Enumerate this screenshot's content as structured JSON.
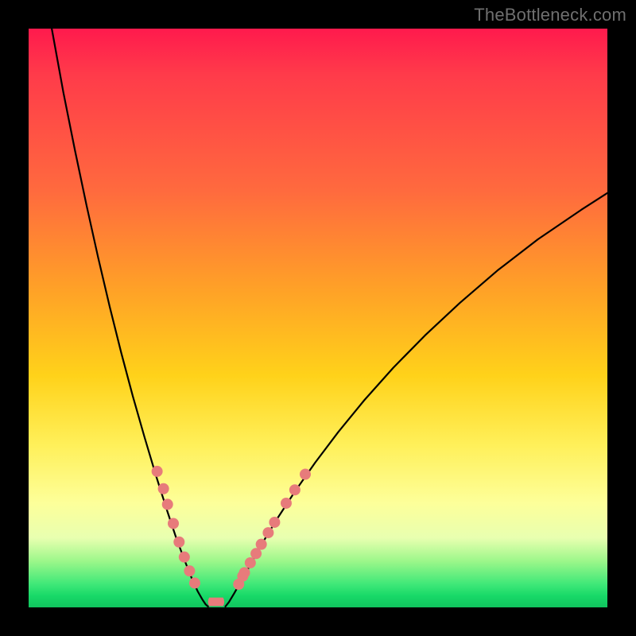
{
  "watermark": "TheBottleneck.com",
  "colors": {
    "curve_stroke": "#000000",
    "dot_fill": "#e77b7b",
    "dot_stroke": "#c95a5a",
    "bottom_arc_fill": "#e77b7b",
    "bottom_arc_stroke": "#c95a5a"
  },
  "chart_data": {
    "type": "line",
    "title": "",
    "xlabel": "",
    "ylabel": "",
    "xlim": [
      0,
      100
    ],
    "ylim": [
      0,
      100
    ],
    "series": [
      {
        "name": "left-branch",
        "x": [
          4,
          6,
          8,
          10,
          12,
          14,
          16,
          18,
          20,
          22,
          24,
          25.5,
          27,
          28.2,
          29.2,
          30,
          30.6,
          31
        ],
        "y": [
          100,
          89,
          79,
          69.5,
          60.5,
          52,
          44,
          36.5,
          29.5,
          22.8,
          16.5,
          12,
          8,
          5,
          2.8,
          1.4,
          0.5,
          0.15
        ]
      },
      {
        "name": "right-branch",
        "x": [
          34,
          34.6,
          35.5,
          36.8,
          38.5,
          40.5,
          43,
          46,
          49.5,
          53.5,
          58,
          63,
          68.5,
          74.5,
          81,
          88,
          95.5,
          100
        ],
        "y": [
          0.15,
          0.9,
          2.4,
          4.7,
          7.7,
          11.3,
          15.4,
          20,
          25,
          30.3,
          35.8,
          41.4,
          47,
          52.6,
          58.2,
          63.6,
          68.7,
          71.6
        ]
      }
    ],
    "dots_left": [
      {
        "x": 22.2,
        "y": 23.5
      },
      {
        "x": 23.3,
        "y": 20.5
      },
      {
        "x": 24.0,
        "y": 17.8
      },
      {
        "x": 25.0,
        "y": 14.5
      },
      {
        "x": 26.0,
        "y": 11.3
      },
      {
        "x": 26.9,
        "y": 8.7
      },
      {
        "x": 27.8,
        "y": 6.3
      },
      {
        "x": 28.7,
        "y": 4.2
      }
    ],
    "dots_right": [
      {
        "x": 36.3,
        "y": 4.0
      },
      {
        "x": 37.0,
        "y": 5.4
      },
      {
        "x": 37.3,
        "y": 6.0
      },
      {
        "x": 38.3,
        "y": 7.7
      },
      {
        "x": 39.3,
        "y": 9.3
      },
      {
        "x": 40.2,
        "y": 10.9
      },
      {
        "x": 41.4,
        "y": 12.9
      },
      {
        "x": 42.5,
        "y": 14.7
      },
      {
        "x": 44.5,
        "y": 18.0
      },
      {
        "x": 46.0,
        "y": 20.3
      },
      {
        "x": 47.8,
        "y": 23.0
      }
    ],
    "bottom_arc": {
      "x0": 29.8,
      "x1": 35.0,
      "y": 0.3,
      "height": 1.4
    }
  }
}
